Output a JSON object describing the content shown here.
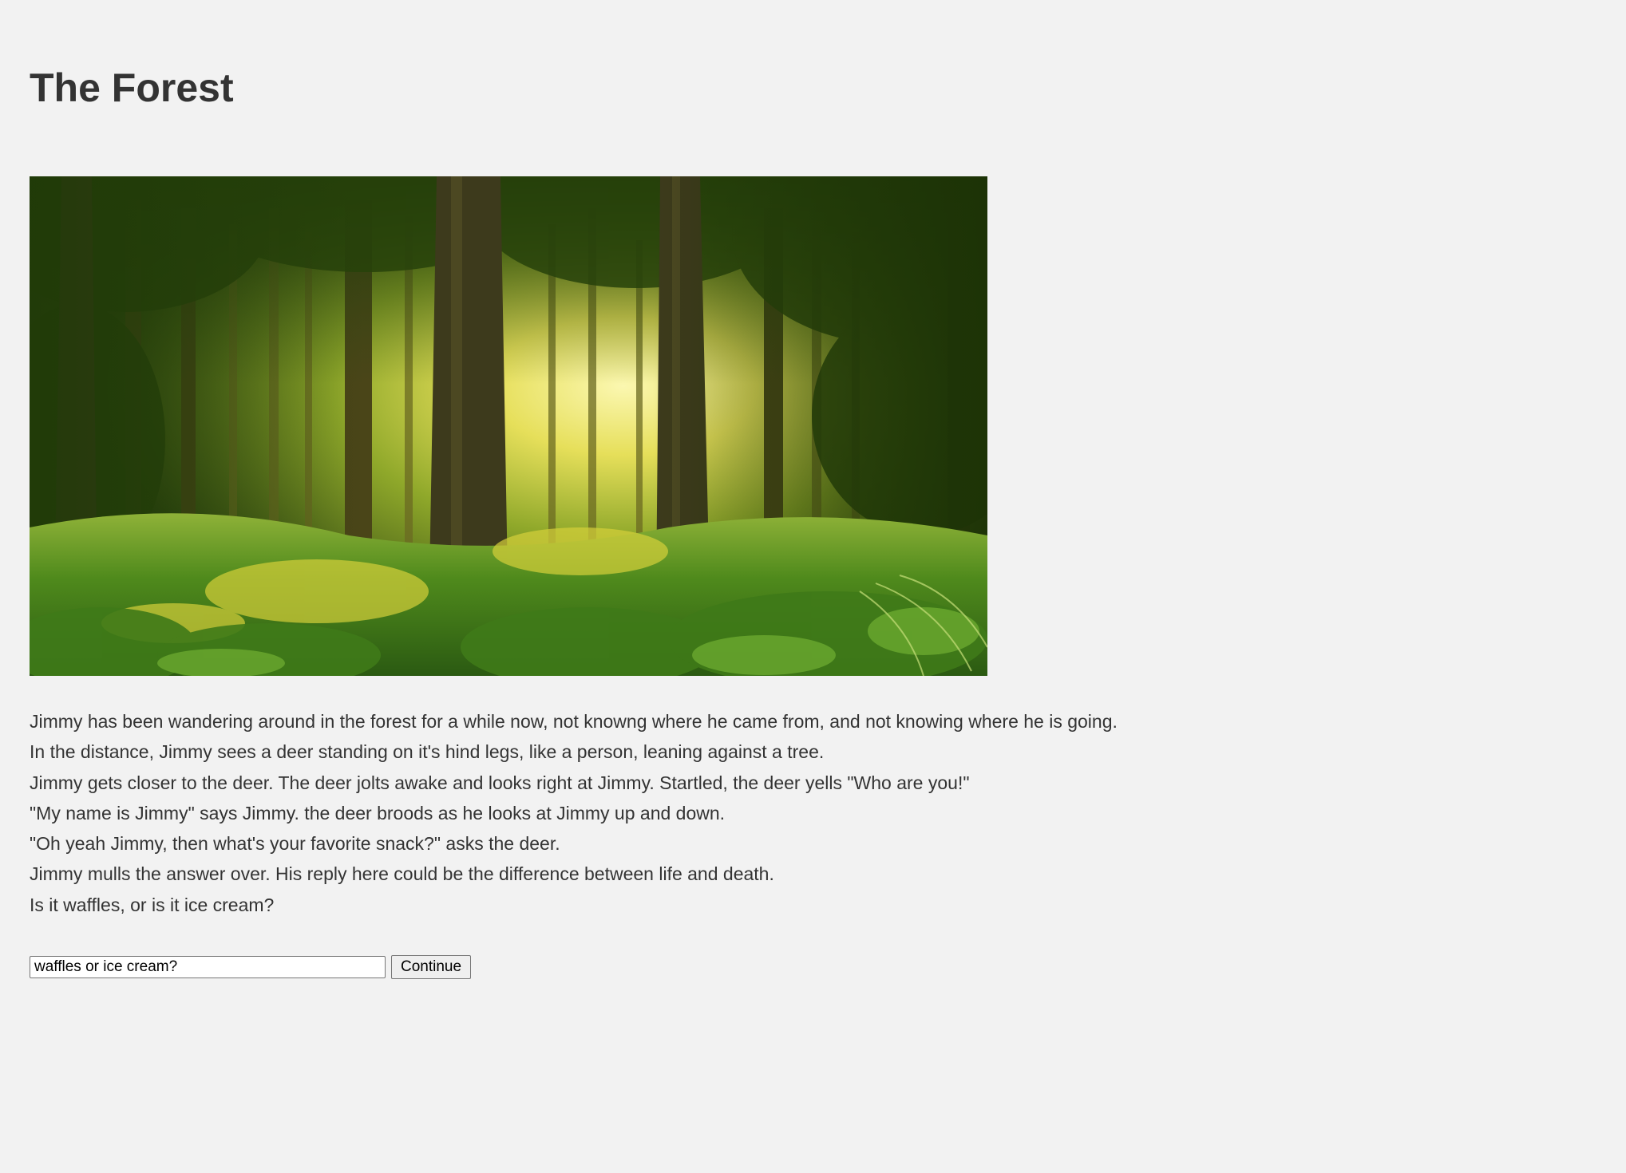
{
  "page": {
    "title": "The Forest"
  },
  "scene_image": {
    "subject": "forest-scene",
    "colors": {
      "sky_light": "#f6f4a8",
      "foliage_dark": "#2f4a10",
      "foliage_mid": "#5f8a1e",
      "trunk": "#3d3a1c",
      "ground": "#6aa02a"
    }
  },
  "story": {
    "lines": [
      "Jimmy has been wandering around in the forest for a while now, not knowng where he came from, and not knowing where he is going.",
      "In the distance, Jimmy sees a deer standing on it's hind legs, like a person, leaning against a tree.",
      "Jimmy gets closer to the deer. The deer jolts awake and looks right at Jimmy. Startled, the deer yells \"Who are you!\"",
      "\"My name is Jimmy\" says Jimmy. the deer broods as he looks at Jimmy up and down.",
      "\"Oh yeah Jimmy, then what's your favorite snack?\" asks the deer.",
      "Jimmy mulls the answer over. His reply here could be the difference between life and death.",
      "Is it waffles, or is it ice cream?"
    ]
  },
  "answer_form": {
    "input_value": "waffles or ice cream?",
    "continue_label": "Continue"
  }
}
